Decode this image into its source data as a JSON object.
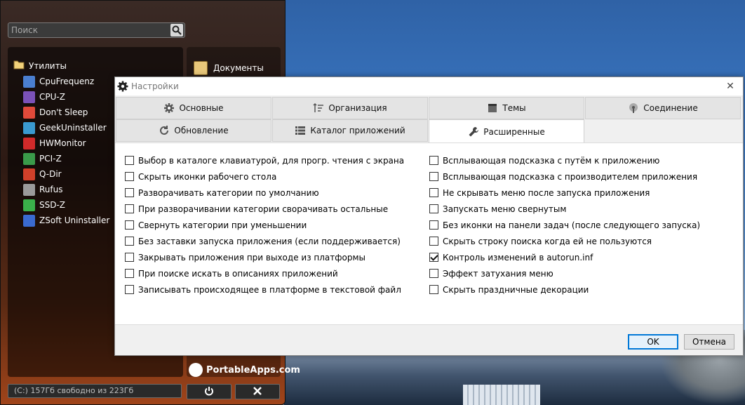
{
  "portableapps": {
    "search_placeholder": "Поиск",
    "category": "Утилиты",
    "apps": [
      {
        "label": "CpuFrequenz",
        "color": "#4a7fd0"
      },
      {
        "label": "CPU-Z",
        "color": "#7b52b8"
      },
      {
        "label": "Don't Sleep",
        "color": "#e04a3a"
      },
      {
        "label": "GeekUninstaller",
        "color": "#3a9ad0"
      },
      {
        "label": "HWMonitor",
        "color": "#d02a2a"
      },
      {
        "label": "PCI-Z",
        "color": "#3a9a4a"
      },
      {
        "label": "Q-Dir",
        "color": "#d0402a"
      },
      {
        "label": "Rufus",
        "color": "#9a9a9a"
      },
      {
        "label": "SSD-Z",
        "color": "#3ab04a"
      },
      {
        "label": "ZSoft Uninstaller",
        "color": "#3a6ad0"
      }
    ],
    "documents_label": "Документы",
    "logo_text": "PortableApps.com",
    "disk_status": "(C:) 157Гб свободно из 223Гб",
    "power_icon": "power-icon",
    "close_icon": "close-icon"
  },
  "dialog": {
    "title": "Настройки",
    "tabs_row1": [
      {
        "label": "Основные",
        "icon": "gear-icon"
      },
      {
        "label": "Организация",
        "icon": "sort-icon"
      },
      {
        "label": "Темы",
        "icon": "theme-icon"
      },
      {
        "label": "Соединение",
        "icon": "antenna-icon"
      }
    ],
    "tabs_row2": [
      {
        "label": "Обновление",
        "icon": "refresh-icon"
      },
      {
        "label": "Каталог приложений",
        "icon": "catalog-icon"
      },
      {
        "label": "Расширенные",
        "icon": "wrench-icon",
        "active": true
      }
    ],
    "left_options": [
      {
        "label": "Выбор в каталоге клавиатурой, для прогр. чтения с экрана",
        "checked": false
      },
      {
        "label": "Скрыть иконки рабочего стола",
        "checked": false
      },
      {
        "label": "Разворачивать категории по умолчанию",
        "checked": false
      },
      {
        "label": "При разворачивании категории сворачивать остальные",
        "checked": false
      },
      {
        "label": "Свернуть категории при уменьшении",
        "checked": false
      },
      {
        "label": "Без заставки запуска приложения (если поддерживается)",
        "checked": false
      },
      {
        "label": "Закрывать приложения при выходе из платформы",
        "checked": false
      },
      {
        "label": "При поиске искать в описаниях приложений",
        "checked": false
      },
      {
        "label": "Записывать происходящее в платформе в текстовой файл",
        "checked": false
      }
    ],
    "right_options": [
      {
        "label": "Всплывающая подсказка с путём к приложению",
        "checked": false
      },
      {
        "label": "Всплывающая подсказка с производителем приложения",
        "checked": false
      },
      {
        "label": "Не скрывать меню после запуска приложения",
        "checked": false
      },
      {
        "label": "Запускать меню свернутым",
        "checked": false
      },
      {
        "label": "Без иконки на панели задач (после следующего запуска)",
        "checked": false
      },
      {
        "label": "Скрыть строку поиска когда ей не пользуются",
        "checked": false
      },
      {
        "label": "Контроль изменений в autorun.inf",
        "checked": true
      },
      {
        "label": "Эффект затухания меню",
        "checked": false
      },
      {
        "label": "Скрыть праздничные декорации",
        "checked": false
      }
    ],
    "ok_label": "OK",
    "cancel_label": "Отмена"
  }
}
